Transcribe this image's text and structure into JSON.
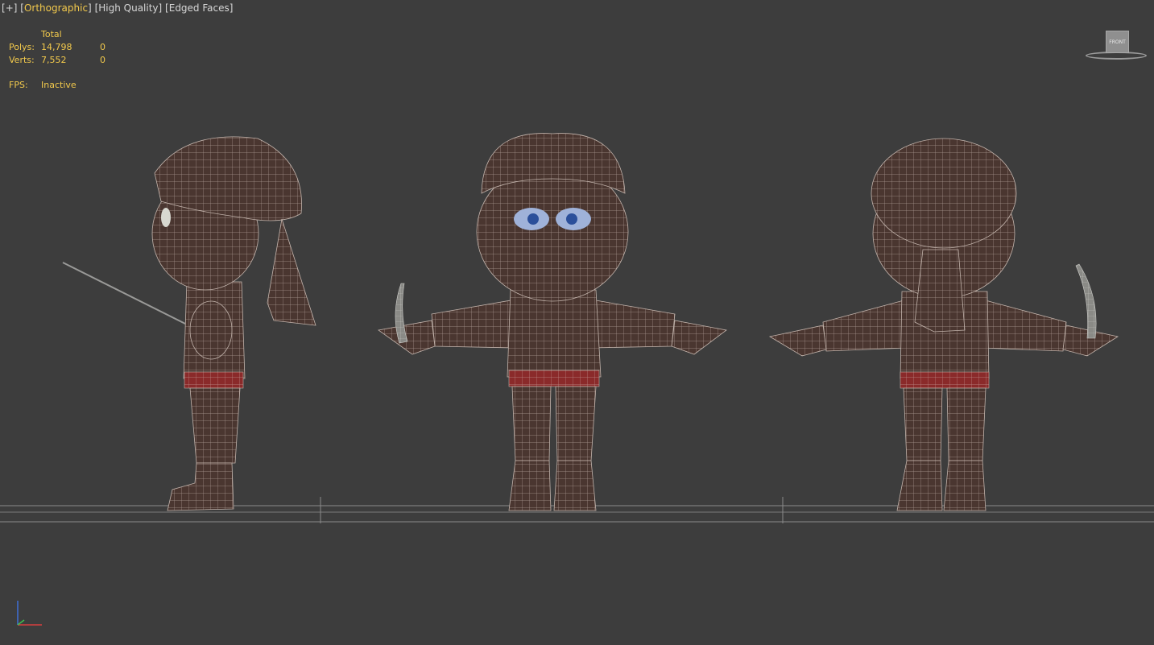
{
  "viewport": {
    "label_plus": "+",
    "label_view": "Orthographic",
    "label_quality": "High Quality",
    "label_shading": "Edged Faces"
  },
  "stats": {
    "header": "Total",
    "rows": [
      {
        "key": "Polys:",
        "total": "14,798",
        "selected": "0"
      },
      {
        "key": "Verts:",
        "total": "7,552",
        "selected": "0"
      }
    ],
    "fps_key": "FPS:",
    "fps_value": "Inactive"
  },
  "viewcube": {
    "face_label": "FRONT"
  },
  "colors": {
    "background": "#3d3d3d",
    "stats_text": "#f2c94c",
    "label_text": "#d6d6d6",
    "mesh_fill": "#4a3630",
    "mesh_wire": "#b9aaa2",
    "belt": "#8a2a2a",
    "eyes": "#9fb2d9",
    "grid_line": "#8a8a8a"
  },
  "icons": [
    "viewcube-icon",
    "axis-tripod-icon"
  ]
}
